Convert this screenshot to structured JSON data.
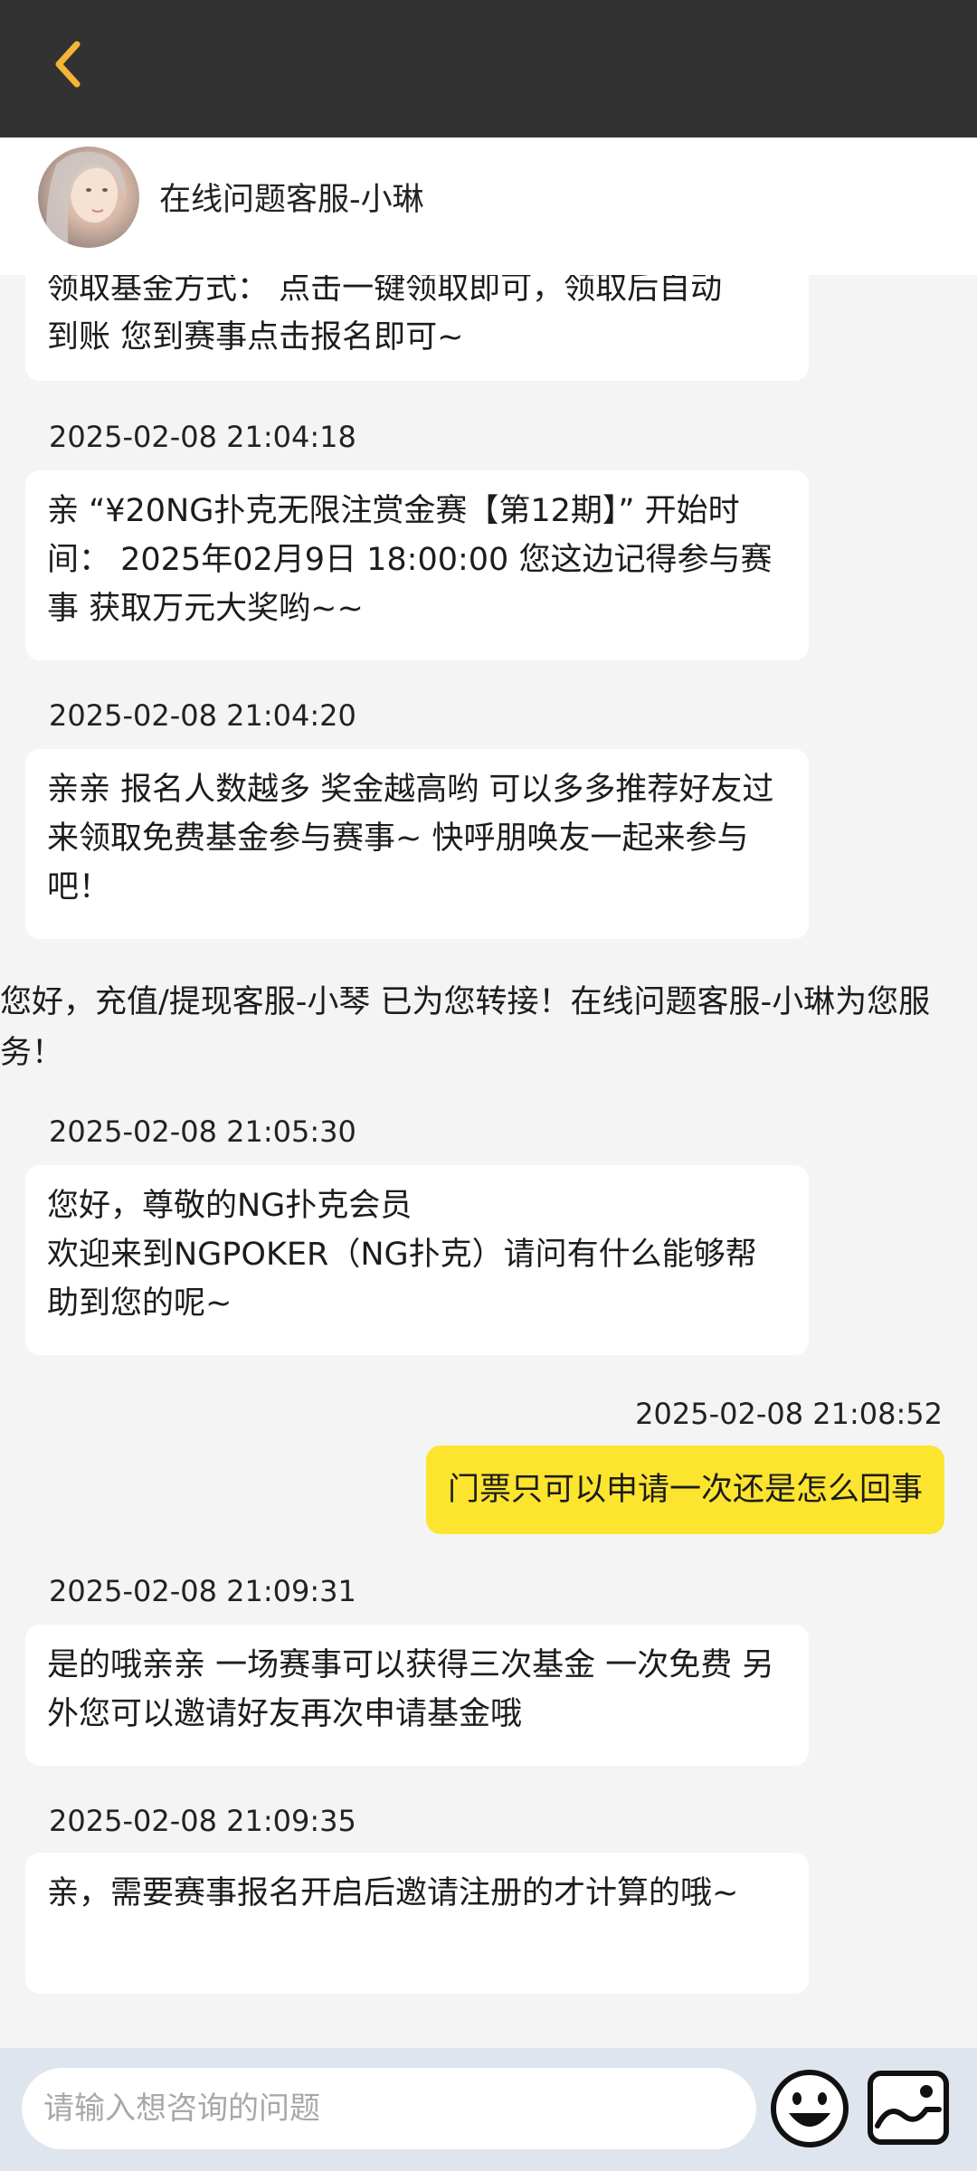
{
  "header": {
    "back_icon": "chevron-left-icon",
    "agent_name": "在线问题客服-小琳"
  },
  "colors": {
    "top_bar": "#323232",
    "accent": "#f5b437",
    "user_bubble": "#fde42f",
    "agent_bubble": "#ffffff",
    "chat_bg": "#f4f4f4",
    "input_bar": "#dfe5ee"
  },
  "messages": {
    "m0": {
      "line1": "领取基金方式： 点击一键领取即可，领取后自动",
      "line2": "到账 您到赛事点击报名即可~"
    },
    "m1": {
      "timestamp": "2025-02-08 21:04:18",
      "text": "亲 “¥20NG扑克无限注赏金赛【第12期】” 开始时间： 2025年02月9日 18:00:00 您这边记得参与赛事 获取万元大奖哟~~"
    },
    "m2": {
      "timestamp": "2025-02-08 21:04:20",
      "text": "亲亲 报名人数越多 奖金越高哟 可以多多推荐好友过来领取免费基金参与赛事~ 快呼朋唤友一起来参与吧！"
    },
    "system": {
      "text": "您好，充值/提现客服-小琴 已为您转接！在线问题客服-小琳为您服务！"
    },
    "m3": {
      "timestamp": "2025-02-08 21:05:30",
      "line1": "您好，尊敬的NG扑克会员",
      "line2": "欢迎来到NGPOKER（NG扑克）请问有什么能够帮助到您的呢~"
    },
    "m4": {
      "timestamp": "2025-02-08 21:08:52",
      "text": "门票只可以申请一次还是怎么回事"
    },
    "m5": {
      "timestamp": "2025-02-08 21:09:31",
      "text": "是的哦亲亲 一场赛事可以获得三次基金 一次免费 另外您可以邀请好友再次申请基金哦"
    },
    "m6": {
      "timestamp": "2025-02-08 21:09:35",
      "text": "亲，需要赛事报名开启后邀请注册的才计算的哦~"
    }
  },
  "input": {
    "placeholder": "请输入想咨询的问题",
    "emoji_icon": "emoji-icon",
    "image_icon": "image-icon"
  }
}
